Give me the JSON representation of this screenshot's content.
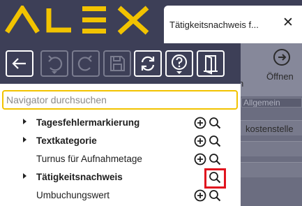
{
  "header": {
    "logo_text": "ALEX",
    "brand_color": "#f2c300",
    "background_color": "#3d3f57"
  },
  "tab": {
    "title": "Tätigkeitsnachweis f...",
    "close_icon": "close-icon"
  },
  "toolbar": {
    "buttons": [
      {
        "name": "back",
        "icon": "arrow-left-icon",
        "enabled": true
      },
      {
        "name": "undo",
        "icon": "undo-icon",
        "enabled": false
      },
      {
        "name": "redo",
        "icon": "redo-icon",
        "enabled": false
      },
      {
        "name": "save",
        "icon": "save-icon",
        "enabled": false
      },
      {
        "name": "refresh",
        "icon": "refresh-icon",
        "enabled": true
      },
      {
        "name": "help",
        "icon": "help-icon",
        "enabled": true
      },
      {
        "name": "exit",
        "icon": "door-icon",
        "enabled": true
      }
    ]
  },
  "navigator": {
    "search_placeholder": "Navigator durchsuchen",
    "items": [
      {
        "label": "Tagesfehlermarkierung",
        "expandable": true,
        "bold": true,
        "has_add": true,
        "has_search": true,
        "highlighted": false
      },
      {
        "label": "Textkategorie",
        "expandable": true,
        "bold": true,
        "has_add": true,
        "has_search": true,
        "highlighted": false
      },
      {
        "label": "Turnus für Aufnahmetage",
        "expandable": false,
        "bold": false,
        "has_add": true,
        "has_search": true,
        "highlighted": false
      },
      {
        "label": "Tätigkeitsnachweis",
        "expandable": true,
        "bold": true,
        "has_add": false,
        "has_search": true,
        "highlighted": true
      },
      {
        "label": "Umbuchungswert",
        "expandable": false,
        "bold": false,
        "has_add": true,
        "has_search": true,
        "highlighted": false
      }
    ],
    "highlight_color": "#e0141e"
  },
  "background_app": {
    "open_label": "Öffnen",
    "partial_letter": "n",
    "field_text": "Allgemein",
    "row_text": "kostenstelle"
  }
}
